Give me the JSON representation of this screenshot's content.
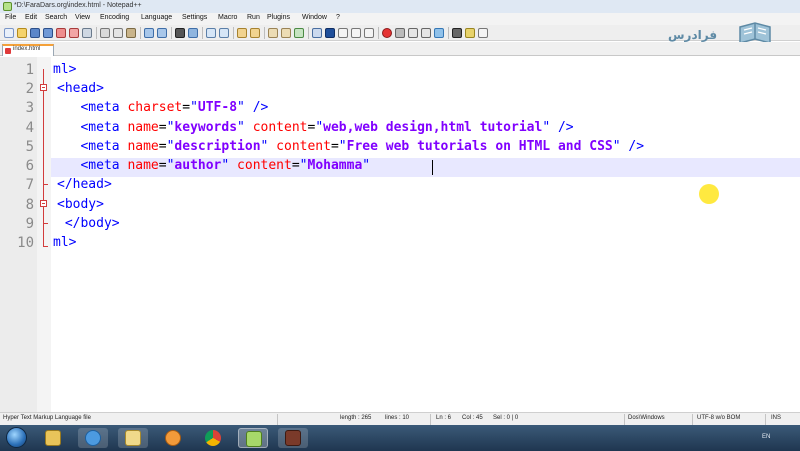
{
  "window": {
    "title": "*D:\\FaraDars.org\\index.html - Notepad++"
  },
  "menu": [
    "File",
    "Edit",
    "Search",
    "View",
    "Encoding",
    "Language",
    "Settings",
    "Macro",
    "Run",
    "Plugins",
    "Window",
    "?"
  ],
  "logo": {
    "text": "فرادرس"
  },
  "tab": {
    "label": "index.html",
    "icon": "modified-file-icon"
  },
  "editor": {
    "line_numbers": [
      "1",
      "2",
      "3",
      "4",
      "5",
      "6",
      "7",
      "8",
      "9",
      "10"
    ],
    "lines": [
      {
        "text": "ml>",
        "visible_fragment": true
      },
      {
        "text": "<head>"
      },
      {
        "text": "<meta charset=\"UTF-8\" />"
      },
      {
        "text": "<meta name=\"keywords\" content=\"web,web design,html tutorial\" />"
      },
      {
        "text": "<meta name=\"description\" content=\"Free web tutorials on HTML and CSS\" />"
      },
      {
        "text": "<meta name=\"author\" content=\"Mohamma\""
      },
      {
        "text": "</head>"
      },
      {
        "text": "<body>"
      },
      {
        "text": "</body>"
      },
      {
        "text": "ml>",
        "visible_fragment": true
      }
    ],
    "current_line": 6
  },
  "status": {
    "file_type": "Hyper Text Markup Language file",
    "length": "length : 265",
    "lines": "lines : 10",
    "ln": "Ln : 6",
    "col": "Col : 45",
    "sel": "Sel : 0 | 0",
    "eol": "Dos\\Windows",
    "encoding": "UTF-8 w/o BOM",
    "mode": "INS"
  },
  "taskbar": {
    "apps": [
      "explorer",
      "internet-explorer",
      "file-manager",
      "media-player",
      "chrome",
      "notepad-plus-plus",
      "other-app"
    ],
    "lang": "EN"
  },
  "colors": {
    "tag": "#0000ff",
    "attribute": "#ff0000",
    "value": "#8000ff",
    "current_line": "#e8e8ff",
    "cursor_highlight": "#ffe100"
  }
}
